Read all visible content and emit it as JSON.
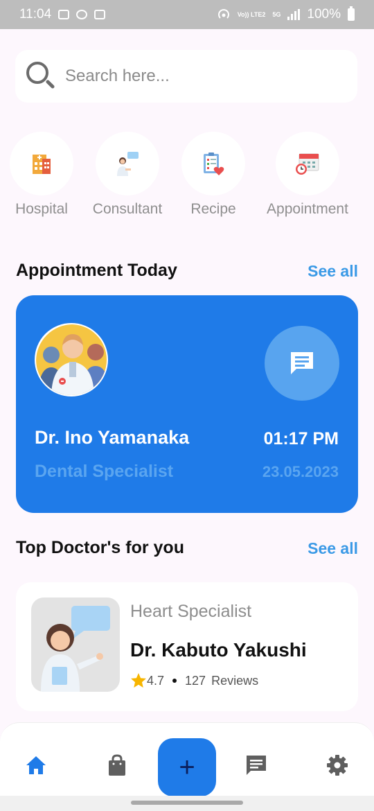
{
  "status_bar": {
    "time": "11:04",
    "network": "Vo)) LTE2",
    "network_5g": "5G",
    "battery": "100%"
  },
  "search": {
    "placeholder": "Search here..."
  },
  "categories": [
    {
      "label": "Hospital",
      "icon": "hospital-icon"
    },
    {
      "label": "Consultant",
      "icon": "consultant-icon"
    },
    {
      "label": "Recipe",
      "icon": "recipe-icon"
    },
    {
      "label": "Appointment",
      "icon": "appointment-icon"
    }
  ],
  "appointment_section": {
    "title": "Appointment Today",
    "see_all": "See all"
  },
  "appointment": {
    "doctor_name": "Dr. Ino Yamanaka",
    "specialty": "Dental Specialist",
    "time": "01:17 PM",
    "date": "23.05.2023"
  },
  "top_doctors_section": {
    "title": "Top Doctor's for you",
    "see_all": "See all"
  },
  "top_doctor": {
    "specialty": "Heart Specialist",
    "name": "Dr. Kabuto Yakushi",
    "rating": "4.7",
    "reviews_count": "127",
    "reviews_label": "Reviews"
  },
  "bottom_nav": {
    "items": [
      "home-icon",
      "shopping-bag-icon",
      "add-icon",
      "message-icon",
      "settings-icon"
    ],
    "add_symbol": "+"
  },
  "colors": {
    "primary": "#1f7be8",
    "link": "#3b9ae6",
    "background": "#fdf7fd"
  }
}
